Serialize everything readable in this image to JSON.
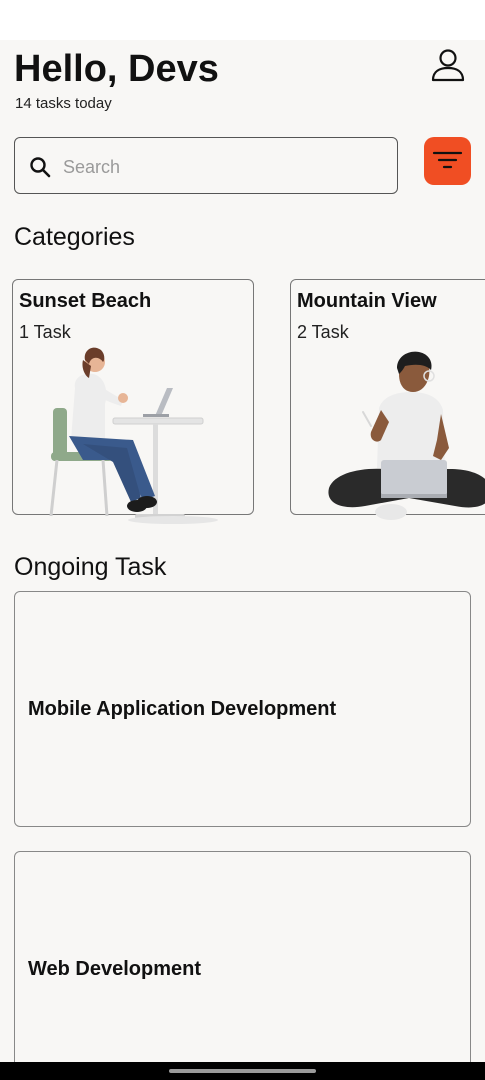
{
  "header": {
    "greeting": "Hello, Devs",
    "subtitle": "14 tasks today"
  },
  "search": {
    "placeholder": "Search",
    "value": ""
  },
  "icons": {
    "profile": "user-profile-icon",
    "search": "search-icon",
    "filter": "filter-lines-icon"
  },
  "colors": {
    "accent": "#f04e23",
    "background": "#f8f7f5",
    "text": "#111111"
  },
  "categories_section": {
    "title": "Categories",
    "items": [
      {
        "title": "Sunset Beach",
        "count": "1 Task"
      },
      {
        "title": "Mountain View",
        "count": "2 Task"
      }
    ]
  },
  "ongoing_section": {
    "title": "Ongoing Task",
    "tasks": [
      {
        "title": "Mobile Application Development"
      },
      {
        "title": "Web Development"
      }
    ]
  }
}
